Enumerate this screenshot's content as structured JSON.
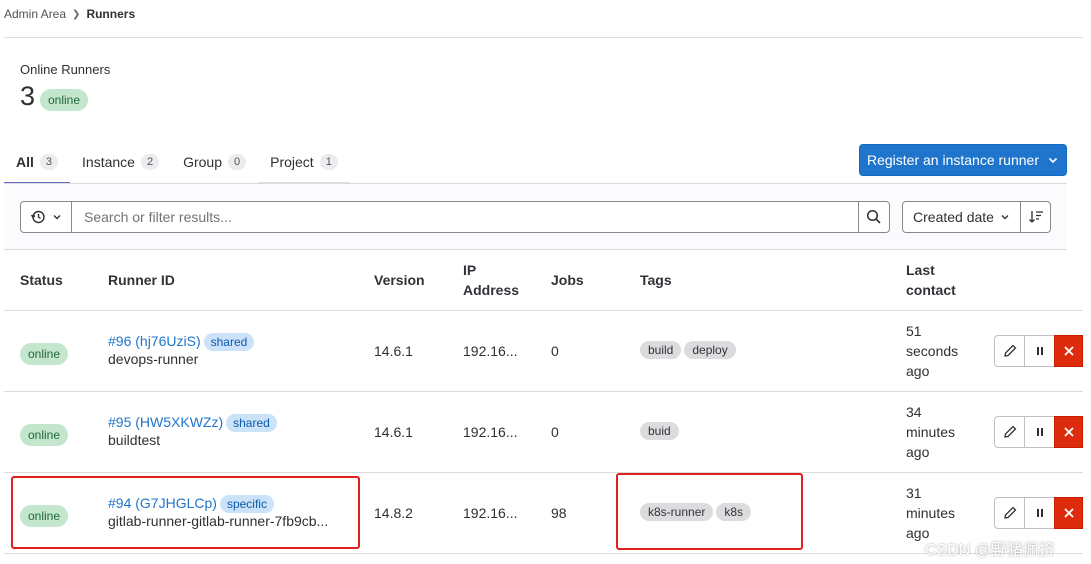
{
  "breadcrumb": {
    "parent": "Admin Area",
    "current": "Runners"
  },
  "stats": {
    "label": "Online Runners",
    "count": "3",
    "badge": "online"
  },
  "tabs": [
    {
      "label": "All",
      "count": "3"
    },
    {
      "label": "Instance",
      "count": "2"
    },
    {
      "label": "Group",
      "count": "0"
    },
    {
      "label": "Project",
      "count": "1"
    }
  ],
  "register_button": "Register an instance runner",
  "filter": {
    "placeholder": "Search or filter results...",
    "sort_label": "Created date"
  },
  "table": {
    "headers": {
      "status": "Status",
      "runner_id": "Runner ID",
      "version": "Version",
      "ip_line1": "IP",
      "ip_line2": "Address",
      "jobs": "Jobs",
      "tags": "Tags",
      "contact_line1": "Last",
      "contact_line2": "contact"
    },
    "rows": [
      {
        "status": "online",
        "id": "#96 (hj76UziS)",
        "type": "shared",
        "description": "devops-runner",
        "version": "14.6.1",
        "ip": "192.16...",
        "jobs": "0",
        "tags": [
          "build",
          "deploy"
        ],
        "contact": [
          "51",
          "seconds",
          "ago"
        ]
      },
      {
        "status": "online",
        "id": "#95 (HW5XKWZz)",
        "type": "shared",
        "description": "buildtest",
        "version": "14.6.1",
        "ip": "192.16...",
        "jobs": "0",
        "tags": [
          "buid"
        ],
        "contact": [
          "34",
          "minutes",
          "ago"
        ]
      },
      {
        "status": "online",
        "id": "#94 (G7JHGLCp)",
        "type": "specific",
        "description": "gitlab-runner-gitlab-runner-7fb9cb...",
        "version": "14.8.2",
        "ip": "192.16...",
        "jobs": "98",
        "tags": [
          "k8s-runner",
          "k8s"
        ],
        "contact": [
          "31",
          "minutes",
          "ago"
        ]
      }
    ]
  },
  "icons": {
    "history": "history-icon",
    "search": "search-icon",
    "sort": "sort-descending-icon",
    "edit": "pencil-icon",
    "pause": "pause-icon",
    "delete": "close-icon",
    "chevron": "chevron-down-icon"
  },
  "colors": {
    "primary": "#1f75cb",
    "danger": "#dd2b0e",
    "online_bg": "#c3e6cd",
    "highlight": "#e02020"
  },
  "watermark": "CSDN @野猪佩挤"
}
